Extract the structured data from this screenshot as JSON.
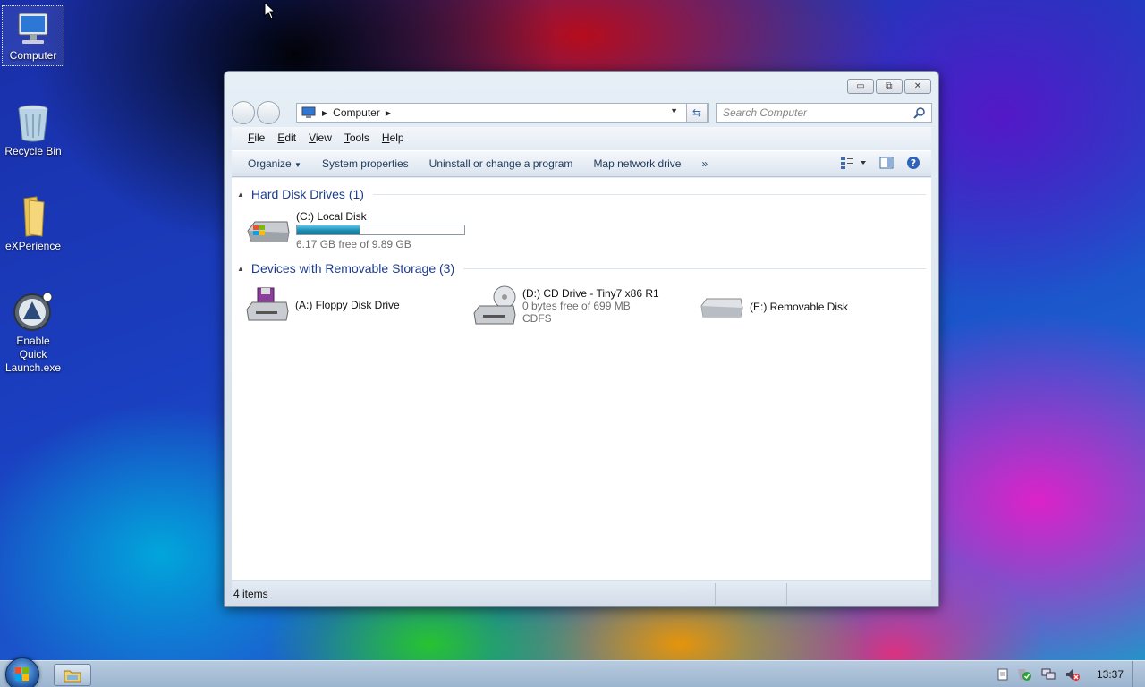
{
  "desktop": {
    "icons": [
      {
        "label": "Computer"
      },
      {
        "label": "Recycle Bin"
      },
      {
        "label": "eXPerience"
      },
      {
        "label": "Enable Quick Launch.exe"
      }
    ]
  },
  "window": {
    "address": {
      "segments": [
        "Computer"
      ]
    },
    "search": {
      "placeholder": "Search Computer"
    },
    "menu": [
      "File",
      "Edit",
      "View",
      "Tools",
      "Help"
    ],
    "toolbar": {
      "organize": "Organize",
      "system_properties": "System properties",
      "uninstall": "Uninstall or change a program",
      "map_drive": "Map network drive",
      "more": "»"
    },
    "groups": {
      "hard_disks": {
        "title": "Hard Disk Drives (1)",
        "drives": [
          {
            "name": "(C:) Local Disk",
            "free": "6.17 GB free of 9.89 GB",
            "used_fraction": 0.376
          }
        ]
      },
      "removable": {
        "title": "Devices with Removable Storage (3)",
        "drives": [
          {
            "name": "(A:) Floppy Disk Drive"
          },
          {
            "name": "(D:) CD Drive - Tiny7 x86 R1",
            "free": "0 bytes free of 699 MB",
            "fs": "CDFS"
          },
          {
            "name": "(E:) Removable Disk"
          }
        ]
      }
    },
    "status": {
      "items": "4 items"
    }
  },
  "taskbar": {
    "clock": "13:37"
  },
  "colors": {
    "accent": "#1e3c8c",
    "progress": "#1e8fb4"
  }
}
